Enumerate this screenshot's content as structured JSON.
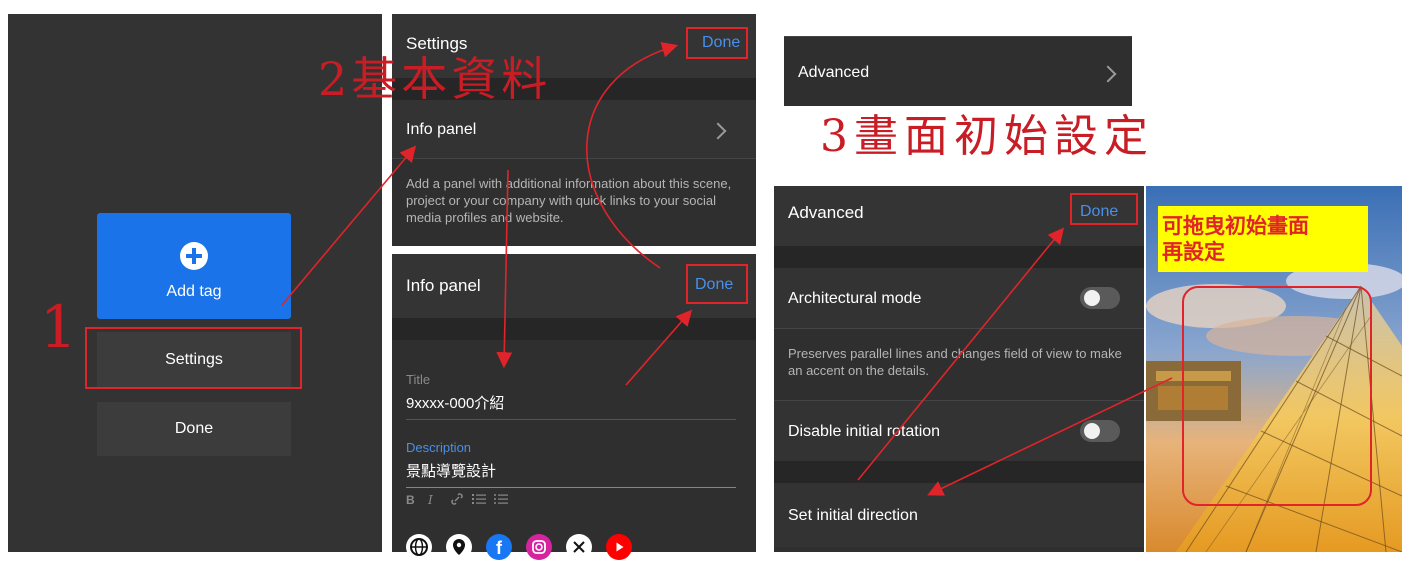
{
  "panel1": {
    "add_tag_label": "Add tag",
    "settings_label": "Settings",
    "done_label": "Done",
    "step_number": "1",
    "colors": {
      "add_tag_bg": "#1a73e8",
      "background": "#333333"
    }
  },
  "step2": {
    "caption": "2基本資料"
  },
  "settings_panel": {
    "title": "Settings",
    "done": "Done",
    "info_panel_label": "Info panel",
    "info_panel_desc": "Add a panel with additional information about this scene, project or your company with quick links to your social media profiles and website."
  },
  "info_panel": {
    "title": "Info panel",
    "done": "Done",
    "title_label": "Title",
    "title_value": "9xxxx-000介紹",
    "description_label": "Description",
    "description_value": "景點導覽設計",
    "toolbar": [
      "B",
      "I",
      "link-icon",
      "numbered-list-icon",
      "bullet-list-icon"
    ],
    "social_icons": [
      "globe-icon",
      "location-pin-icon",
      "facebook-icon",
      "instagram-icon",
      "x-icon",
      "youtube-icon"
    ]
  },
  "advanced_row": {
    "label": "Advanced"
  },
  "step3": {
    "caption": "3畫面初始設定"
  },
  "advanced_panel": {
    "title": "Advanced",
    "done": "Done",
    "architectural_mode_label": "Architectural mode",
    "architectural_mode_on": false,
    "architectural_mode_desc": "Preserves parallel lines and changes field of view to make an accent on the details.",
    "disable_rotation_label": "Disable initial rotation",
    "disable_rotation_on": false,
    "set_direction_label": "Set initial direction"
  },
  "preview": {
    "callout_line1": "可拖曳初始畫面",
    "callout_line2": "再設定"
  }
}
